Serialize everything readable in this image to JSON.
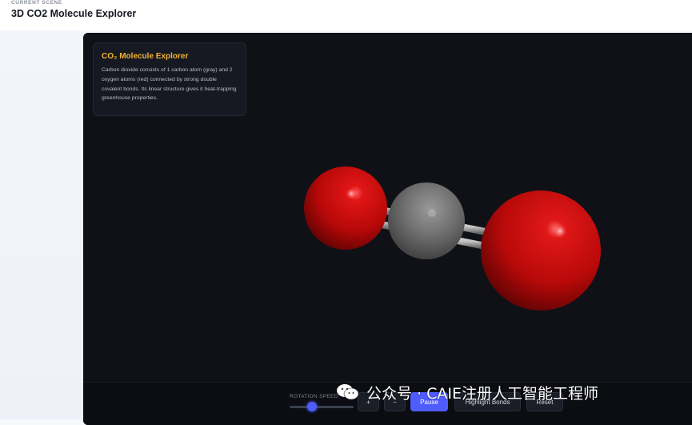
{
  "header": {
    "kicker": "CURRENT SCENE",
    "title": "3D CO2 Molecule Explorer"
  },
  "info": {
    "title": "CO₂ Molecule Explorer",
    "description": "Carbon dioxide consists of 1 carbon atom (gray) and 2 oxygen atoms (red) connected by strong double covalent bonds. Its linear structure gives it heat-trapping greenhouse properties."
  },
  "colors": {
    "accent": "#4f5dff",
    "title_accent": "#f2b233",
    "oxygen": "#c80b0b",
    "carbon": "#6f6f6f",
    "bond": "#9a9a9a",
    "viewport_bg": "#0f1117"
  },
  "controls": {
    "speed_label": "ROTATION SPEED",
    "speed_value": 0.35,
    "zoom_in_label": "+",
    "zoom_out_label": "−",
    "pause_label": "Pause",
    "highlight_label": "Highlight Bonds",
    "reset_label": "Reset"
  },
  "watermark": {
    "text": "公众号 · CAIE注册人工智能工程师",
    "icon": "wechat-icon"
  }
}
